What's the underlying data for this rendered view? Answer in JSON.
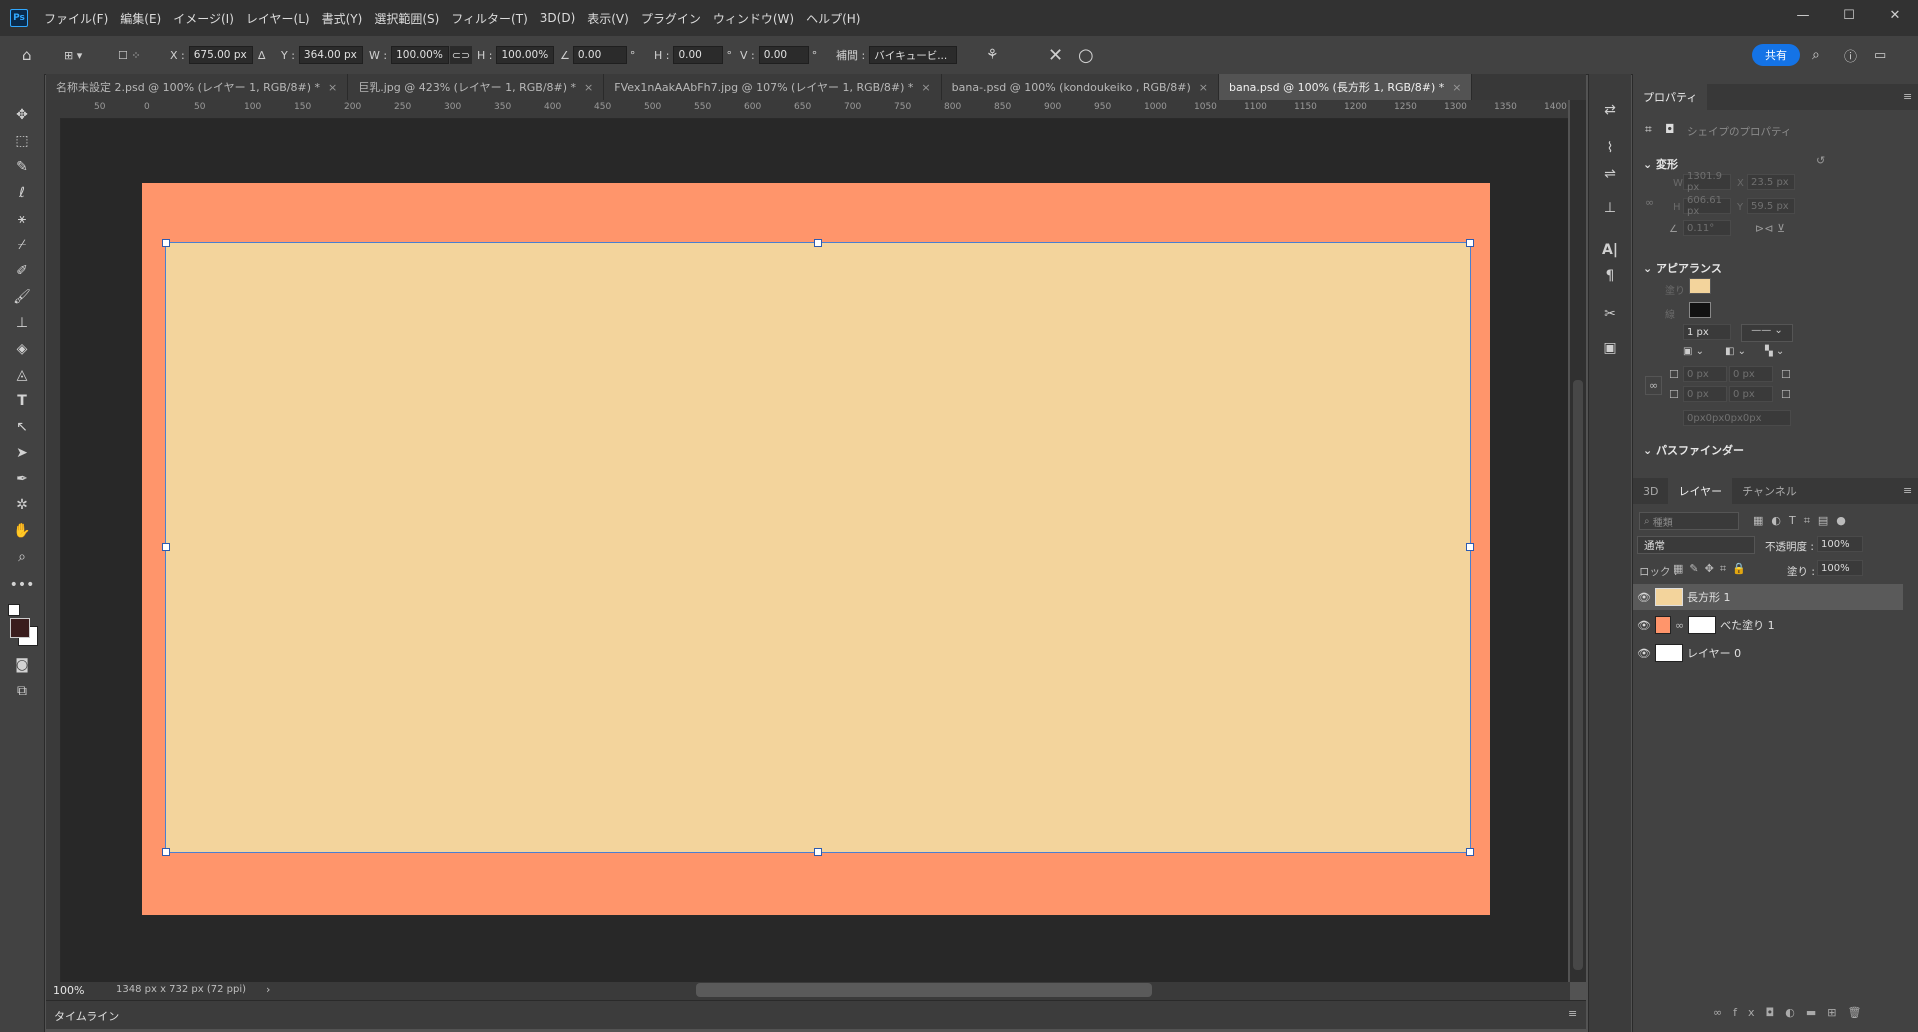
{
  "app": {
    "logo": "Ps"
  },
  "menu": [
    "ファイル(F)",
    "編集(E)",
    "イメージ(I)",
    "レイヤー(L)",
    "書式(Y)",
    "選択範囲(S)",
    "フィルター(T)",
    "3D(D)",
    "表示(V)",
    "プラグイン",
    "ウィンドウ(W)",
    "ヘルプ(H)"
  ],
  "window_controls": {
    "minimize": "—",
    "maximize": "☐",
    "close": "✕"
  },
  "options": {
    "x_label": "X :",
    "x_value": "675.00 px",
    "y_label": "Y :",
    "y_value": "364.00 px",
    "w_label": "W :",
    "w_value": "100.00%",
    "h_label": "H :",
    "h_value": "100.00%",
    "angle_value": "0.00",
    "angle_unit": "°",
    "hskew_label": "H :",
    "hskew_value": "0.00",
    "hskew_unit": "°",
    "vskew_label": "V :",
    "vskew_value": "0.00",
    "vskew_unit": "°",
    "interp_label": "補間 :",
    "interp_value": "バイキュービ...",
    "cancel": "✕",
    "commit": "○",
    "share": "共有"
  },
  "tabs": [
    {
      "label": "名称未設定 2.psd @ 100% (レイヤー 1, RGB/8#) *",
      "close": "×"
    },
    {
      "label": "巨乳.jpg @ 423% (レイヤー 1, RGB/8#) *",
      "close": "×"
    },
    {
      "label": "FVex1nAakAAbFh7.jpg @ 107% (レイヤー 1, RGB/8#) *",
      "close": "×"
    },
    {
      "label": "bana-.psd @ 100% (kondoukeiko , RGB/8#)",
      "close": "×"
    },
    {
      "label": "bana.psd @ 100% (長方形 1, RGB/8#) *",
      "close": "×"
    }
  ],
  "ruler_ticks": [
    "50",
    "0",
    "50",
    "100",
    "150",
    "200",
    "250",
    "300",
    "350",
    "400",
    "450",
    "500",
    "550",
    "600",
    "650",
    "700",
    "750",
    "800",
    "850",
    "900",
    "950",
    "1000",
    "1050",
    "1100",
    "1150",
    "1200",
    "1250",
    "1300",
    "1350",
    "1400"
  ],
  "status": {
    "zoom": "100%",
    "size": "1348 px x 732 px (72 ppi)",
    "arrow": "›"
  },
  "timeline": {
    "label": "タイムライン"
  },
  "colors": {
    "outer": "#ff956b",
    "inner": "#f3d49c",
    "accent": "#1473e6"
  },
  "properties": {
    "tab": "プロパティ",
    "shape_props": "シェイプのプロパティ",
    "transform_title": "変形",
    "w_label": "W",
    "w_value": "1301.9 px",
    "x_label": "X",
    "x_value": "23.5 px",
    "h_label": "H",
    "h_value": "606.61 px",
    "y_label": "Y",
    "y_value": "59.5 px",
    "angle_value": "0.11°",
    "appearance_title": "アピアランス",
    "fill_label": "塗り",
    "stroke_label": "線",
    "stroke_width": "1 px",
    "corner_values": [
      "0 px",
      "0 px",
      "0 px",
      "0 px"
    ],
    "corner_all": "0px0px0px0px",
    "pathfinder_title": "パスファインダー"
  },
  "layers_panel": {
    "tabs": [
      "3D",
      "レイヤー",
      "チャンネル"
    ],
    "search_placeholder": "種類",
    "blend_mode": "通常",
    "opacity_label": "不透明度 :",
    "opacity_value": "100%",
    "lock_label": "ロック :",
    "fill_label": "塗り :",
    "fill_value": "100%",
    "layers": [
      {
        "name": "長方形 1",
        "thumb": "#f3d49c",
        "selected": true
      },
      {
        "name": "べた塗り 1",
        "thumb": "#ff956b",
        "selected": false
      },
      {
        "name": "レイヤー 0",
        "thumb": "#ffffff",
        "selected": false
      }
    ]
  }
}
